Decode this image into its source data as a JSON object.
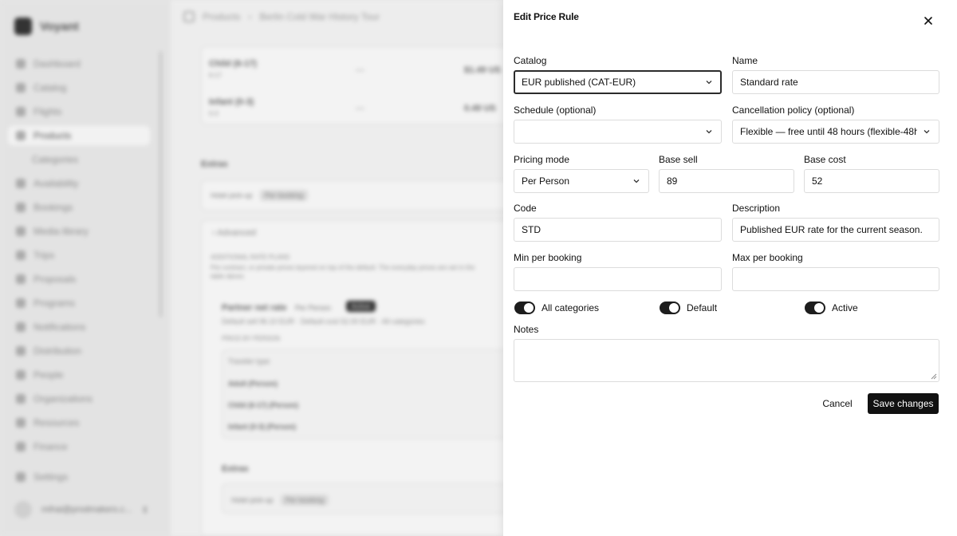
{
  "background": {
    "brand": "Voyant",
    "nav": [
      "Dashboard",
      "Catalog",
      "Flights",
      "Products",
      "Categories",
      "Availability",
      "Bookings",
      "Media library",
      "Trips",
      "Proposals",
      "Programs",
      "Notifications",
      "Distribution",
      "People",
      "Organizations",
      "Resources",
      "Finance",
      "Settings"
    ],
    "active_nav": "Products",
    "user_email": "mihai@prodmakers.c...",
    "breadcrumb": [
      "Products",
      "Berlin Cold War History Tour"
    ],
    "rows": [
      {
        "name": "Child (6-17)",
        "sub": "6-17",
        "dash": "—",
        "price": "$1.49 US"
      },
      {
        "name": "Infant (0-3)",
        "sub": "0-3",
        "dash": "—",
        "price": "0.49 US"
      }
    ],
    "extras_heading": "Extras",
    "extras_chip_a": "Hotel pick-up",
    "extras_chip_b": "Per booking",
    "advanced_label": "Advanced",
    "additional_heading": "ADDITIONAL RATE PLANS",
    "additional_desc": "Per-contract, or private prices layered on top of the default. The everyday prices are set in the table above.",
    "partner_title": "Partner net rate",
    "partner_pill": "Per Person",
    "partner_badge": "Active",
    "partner_meta": "Default sell 96.10 EUR · Default cost 52.00 EUR · All categories",
    "partner_sub": "PRICE BY PERSON",
    "traveler_heading": "Traveler type",
    "travelers": [
      "Adult (Person)",
      "Child (6-17) (Person)",
      "Infant (0-3) (Person)"
    ],
    "extras2_heading": "Extras",
    "extras2_chip_a": "Hotel pick-up",
    "extras2_chip_b": "Per booking"
  },
  "dialog": {
    "title": "Edit Price Rule",
    "catalog": {
      "label": "Catalog",
      "value": "EUR published (CAT-EUR)"
    },
    "name": {
      "label": "Name",
      "value": "Standard rate"
    },
    "schedule": {
      "label": "Schedule (optional)",
      "value": ""
    },
    "cancellation": {
      "label": "Cancellation policy (optional)",
      "value": "Flexible — free until 48 hours (flexible-48h)"
    },
    "pricing_mode": {
      "label": "Pricing mode",
      "value": "Per Person"
    },
    "base_sell": {
      "label": "Base sell",
      "value": "89"
    },
    "base_cost": {
      "label": "Base cost",
      "value": "52"
    },
    "code": {
      "label": "Code",
      "value": "STD"
    },
    "description": {
      "label": "Description",
      "value": "Published EUR rate for the current season."
    },
    "min_per_booking": {
      "label": "Min per booking",
      "value": ""
    },
    "max_per_booking": {
      "label": "Max per booking",
      "value": ""
    },
    "toggles": {
      "all_categories": {
        "label": "All categories",
        "on": true
      },
      "default": {
        "label": "Default",
        "on": true
      },
      "active": {
        "label": "Active",
        "on": true
      }
    },
    "notes": {
      "label": "Notes",
      "value": ""
    },
    "cancel_label": "Cancel",
    "save_label": "Save changes"
  }
}
